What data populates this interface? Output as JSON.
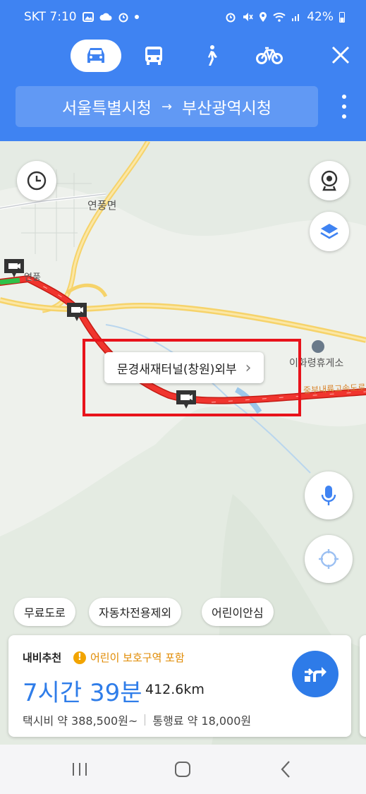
{
  "status_bar": {
    "carrier_time": "SKT 7:10",
    "battery": "42%"
  },
  "header": {
    "modes": [
      "car-icon",
      "bus-icon",
      "walk-icon",
      "bike-icon"
    ],
    "active_mode": "car",
    "route": {
      "origin": "서울특별시청",
      "arrow": "→",
      "destination": "부산광역시청"
    }
  },
  "map": {
    "labels": {
      "town": "연풍면",
      "small_town": "연풍",
      "rest_area": "이화령휴게소",
      "highway": "중부내륙고속도로"
    },
    "tooltip": {
      "text": "문경새재터널(창원)외부",
      "chevron": "›"
    },
    "route_color": "#f0352e"
  },
  "filters": [
    "무료도로",
    "자동차전용제외",
    "어린이안심"
  ],
  "route_card": {
    "recommend_label": "내비추천",
    "warning_icon": "!",
    "warning_text": "어린이 보호구역 포함",
    "duration": "7시간 39분",
    "distance": "412.6km",
    "taxi_fare": "택시비 약 388,500원~",
    "toll_fare": "통행료 약 18,000원"
  },
  "colors": {
    "accent": "#3f83f2",
    "route": "#f0352e",
    "highlight_box": "#e8131b",
    "time_text": "#2f7de9"
  }
}
